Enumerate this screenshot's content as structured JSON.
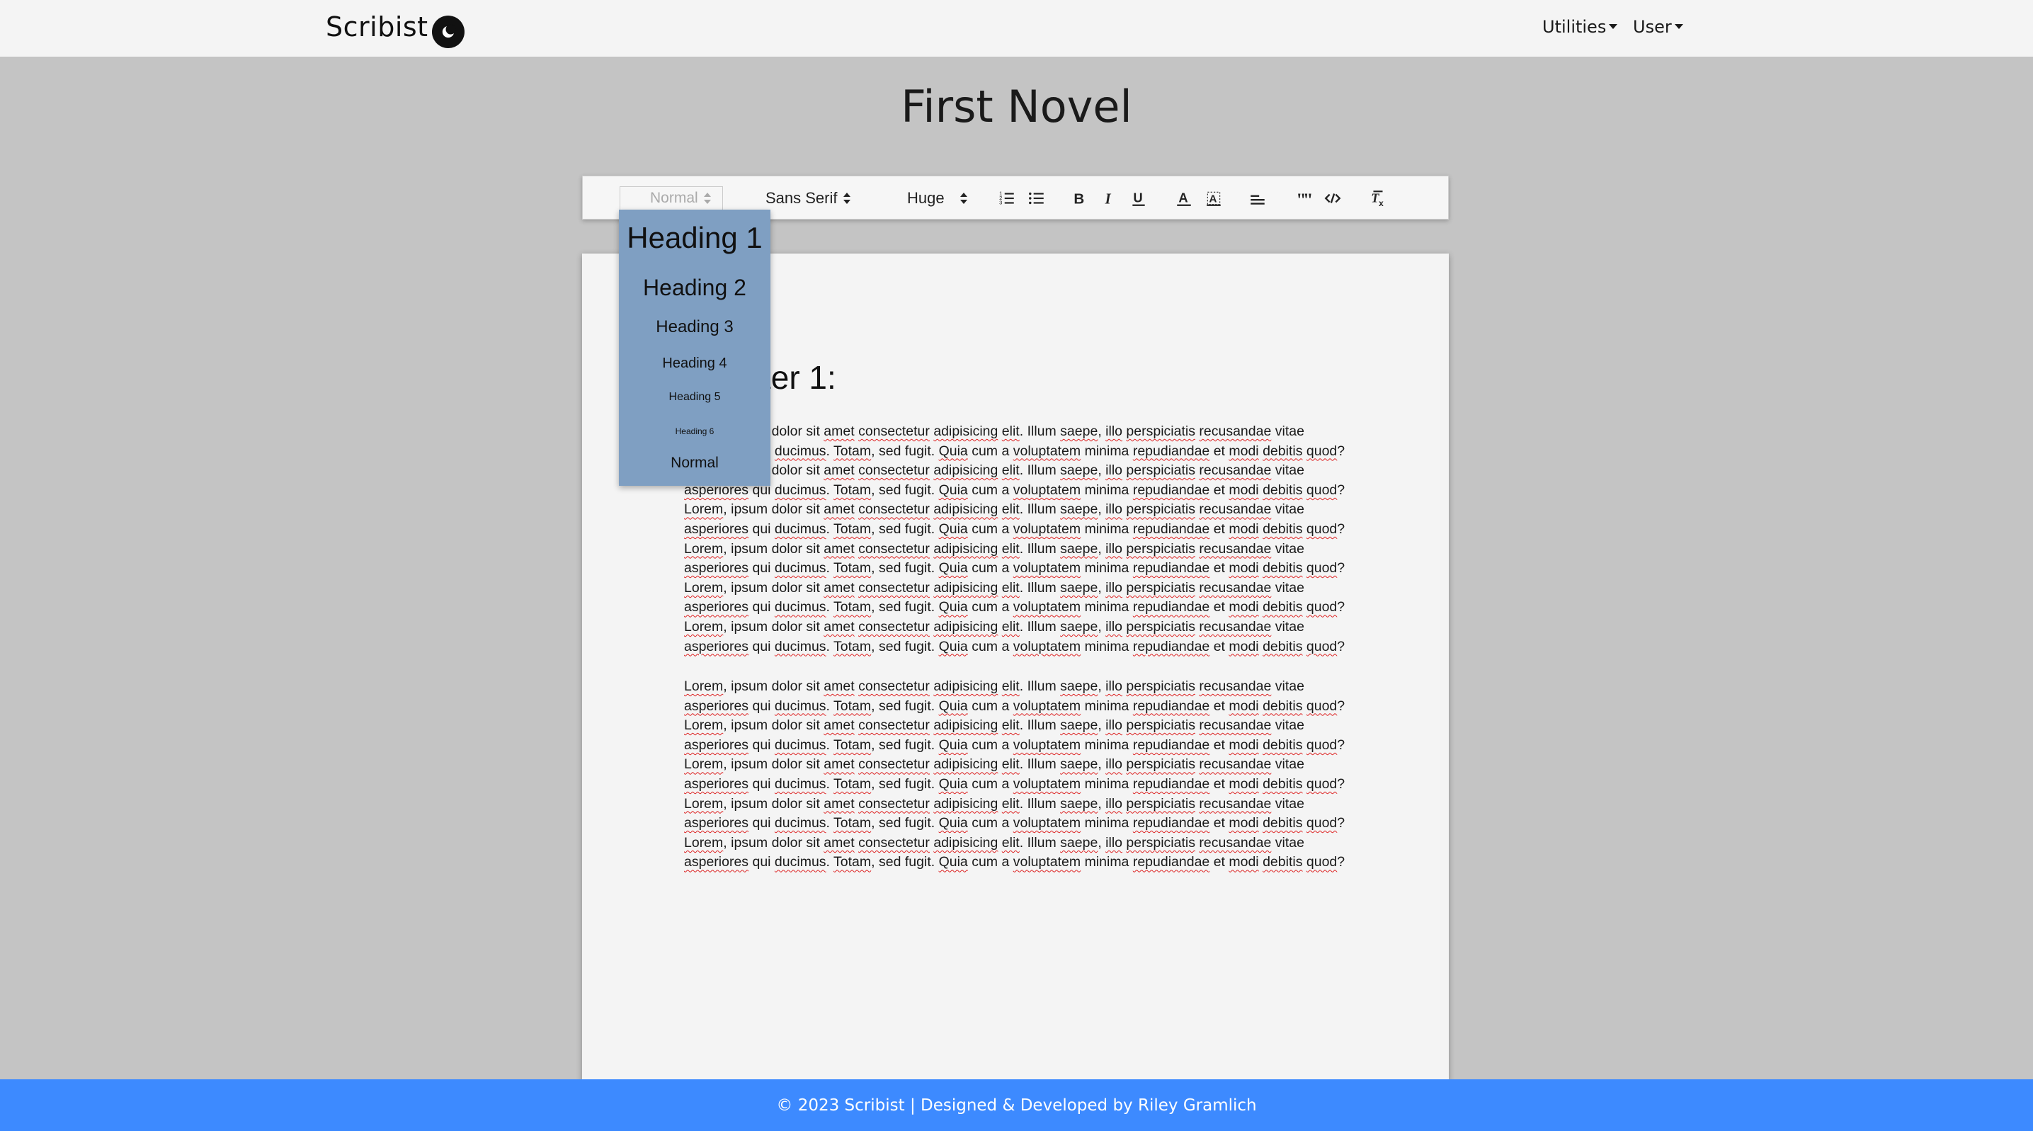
{
  "navbar": {
    "brand": "Scribist",
    "theme_icon": "moon-icon",
    "menus": [
      {
        "label": "Utilities"
      },
      {
        "label": "User"
      }
    ]
  },
  "document": {
    "title": "First Novel"
  },
  "toolbar": {
    "header_picker": {
      "selected": "Normal"
    },
    "font_picker": {
      "selected": "Sans Serif"
    },
    "size_picker": {
      "selected": "Huge"
    },
    "buttons": [
      {
        "icon": "ordered-list-icon"
      },
      {
        "icon": "bullet-list-icon"
      },
      {
        "icon": "bold-icon"
      },
      {
        "icon": "italic-icon"
      },
      {
        "icon": "underline-icon"
      },
      {
        "icon": "text-color-icon"
      },
      {
        "icon": "background-color-icon"
      },
      {
        "icon": "align-icon"
      },
      {
        "icon": "blockquote-icon"
      },
      {
        "icon": "code-block-icon"
      },
      {
        "icon": "clear-format-icon"
      }
    ]
  },
  "header_dropdown": {
    "options": [
      "Heading 1",
      "Heading 2",
      "Heading 3",
      "Heading 4",
      "Heading 5",
      "Heading 6",
      "Normal"
    ]
  },
  "editor": {
    "chapter_heading": "Chapter 1:",
    "line_a": "Lorem, ipsum dolor sit amet consectetur adipisicing elit. Illum saepe, illo perspiciatis recusandae vitae",
    "line_b": "asperiores qui ducimus. Totam, sed fugit. Quia cum a voluptatem minima repudiandae et modi debitis quod?",
    "paragraph_1_repeats": 6,
    "paragraph_2_repeats": 5
  },
  "footer": {
    "text": "© 2023 Scribist | Designed & Developed by Riley Gramlich"
  }
}
